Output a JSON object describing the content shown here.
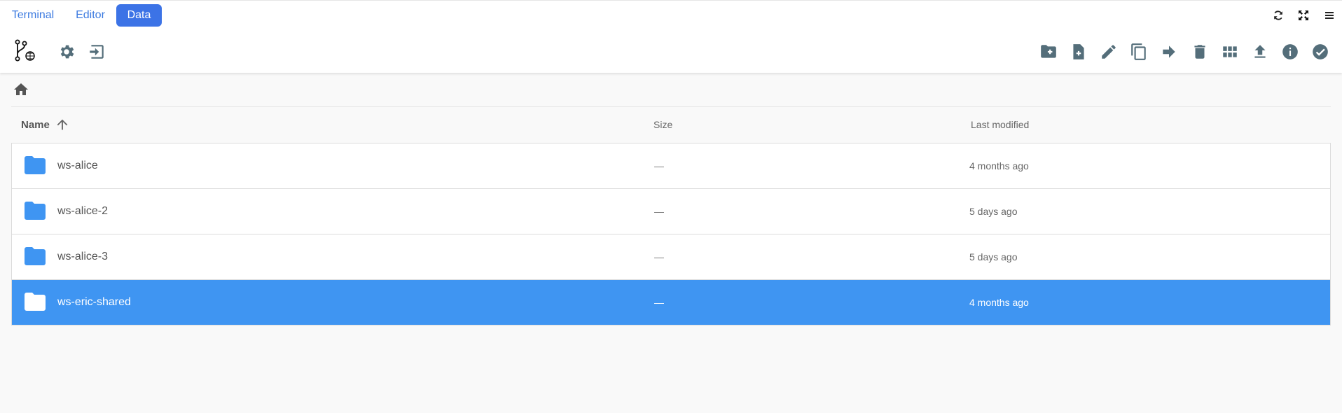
{
  "tabs": [
    {
      "label": "Terminal"
    },
    {
      "label": "Editor"
    },
    {
      "label": "Data",
      "active": true
    }
  ],
  "top_right_icons": [
    "refresh-icon",
    "fullscreen-icon",
    "menu-icon"
  ],
  "toolbar": {
    "left_icons": [
      "git-icon",
      "gear-icon",
      "logout-icon"
    ],
    "right_icons": [
      "new-folder-icon",
      "new-file-icon",
      "rename-icon",
      "copy-icon",
      "move-icon",
      "delete-icon",
      "grid-view-icon",
      "upload-icon",
      "info-icon",
      "select-icon"
    ]
  },
  "breadcrumb": {
    "icon": "home-icon"
  },
  "columns": {
    "name": "Name",
    "size": "Size",
    "modified": "Last modified",
    "sort": "ascending"
  },
  "rows": [
    {
      "name": "ws-alice",
      "size": "—",
      "modified": "4 months ago",
      "selected": false
    },
    {
      "name": "ws-alice-2",
      "size": "—",
      "modified": "5 days ago",
      "selected": false
    },
    {
      "name": "ws-alice-3",
      "size": "—",
      "modified": "5 days ago",
      "selected": false
    },
    {
      "name": "ws-eric-shared",
      "size": "—",
      "modified": "4 months ago",
      "selected": true
    }
  ],
  "colors": {
    "accent": "#3c73e6",
    "tab_text": "#3d7be0",
    "selection": "#3f95f2",
    "folder": "#3f95f2",
    "icon": "#546e7a"
  }
}
